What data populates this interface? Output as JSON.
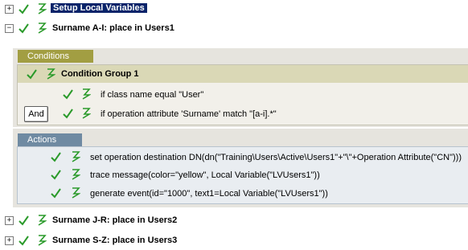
{
  "rules": [
    {
      "id": "r1",
      "expander": "+",
      "title": "Setup Local Variables",
      "selected": true
    },
    {
      "id": "r2",
      "expander": "−",
      "title": "Surname A-I: place in Users1",
      "selected": false
    },
    {
      "id": "r3",
      "expander": "+",
      "title": "Surname J-R: place in Users2",
      "selected": false
    },
    {
      "id": "r4",
      "expander": "+",
      "title": "Surname S-Z: place in Users3",
      "selected": false
    }
  ],
  "conditions": {
    "tab_label": "Conditions",
    "group_title": "Condition Group 1",
    "items": [
      "if class name equal \"User\"",
      "if operation attribute 'Surname' match \"[a-i].*\""
    ],
    "operator_label": "And"
  },
  "actions": {
    "tab_label": "Actions",
    "items": [
      "set operation destination DN(dn(\"Training\\Users\\Active\\Users1\"+\"\\\"+Operation Attribute(\"CN\")))",
      "trace message(color=\"yellow\", Local Variable(\"LVUsers1\"))",
      "generate event(id=\"1000\", text1=Local Variable(\"LVUsers1\"))"
    ]
  },
  "colors": {
    "check_green": "#2a9a2a",
    "toggle_green": "#2a9a2a",
    "selection": "#0a246a",
    "conditions_tab": "#a29e42",
    "actions_tab": "#6f8aa2"
  },
  "icons": {
    "expander": "plus-minus-box-icon",
    "enabled": "green-check-icon",
    "toggle": "z-toggle-icon"
  }
}
